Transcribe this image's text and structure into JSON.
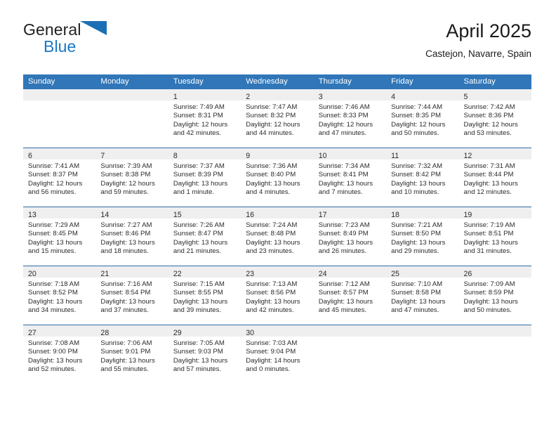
{
  "brand": {
    "name_top": "General",
    "name_bottom": "Blue",
    "triangle_icon": "triangle-icon",
    "color_dark": "#221f1f",
    "color_blue": "#1878c8"
  },
  "header": {
    "title": "April 2025",
    "subtitle": "Castejon, Navarre, Spain"
  },
  "theme": {
    "header_row_bg": "#3076b8",
    "row_divider": "#2e6da4",
    "daynum_band_bg": "#efefef",
    "text": "#2b2b2b"
  },
  "calendar": {
    "weekday_headers": [
      "Sunday",
      "Monday",
      "Tuesday",
      "Wednesday",
      "Thursday",
      "Friday",
      "Saturday"
    ],
    "weeks": [
      [
        {
          "day": "",
          "empty": true,
          "sunrise": "",
          "sunset": "",
          "daylight_1": "",
          "daylight_2": ""
        },
        {
          "day": "",
          "empty": true,
          "sunrise": "",
          "sunset": "",
          "daylight_1": "",
          "daylight_2": ""
        },
        {
          "day": "1",
          "empty": false,
          "sunrise": "Sunrise: 7:49 AM",
          "sunset": "Sunset: 8:31 PM",
          "daylight_1": "Daylight: 12 hours",
          "daylight_2": "and 42 minutes."
        },
        {
          "day": "2",
          "empty": false,
          "sunrise": "Sunrise: 7:47 AM",
          "sunset": "Sunset: 8:32 PM",
          "daylight_1": "Daylight: 12 hours",
          "daylight_2": "and 44 minutes."
        },
        {
          "day": "3",
          "empty": false,
          "sunrise": "Sunrise: 7:46 AM",
          "sunset": "Sunset: 8:33 PM",
          "daylight_1": "Daylight: 12 hours",
          "daylight_2": "and 47 minutes."
        },
        {
          "day": "4",
          "empty": false,
          "sunrise": "Sunrise: 7:44 AM",
          "sunset": "Sunset: 8:35 PM",
          "daylight_1": "Daylight: 12 hours",
          "daylight_2": "and 50 minutes."
        },
        {
          "day": "5",
          "empty": false,
          "sunrise": "Sunrise: 7:42 AM",
          "sunset": "Sunset: 8:36 PM",
          "daylight_1": "Daylight: 12 hours",
          "daylight_2": "and 53 minutes."
        }
      ],
      [
        {
          "day": "6",
          "empty": false,
          "sunrise": "Sunrise: 7:41 AM",
          "sunset": "Sunset: 8:37 PM",
          "daylight_1": "Daylight: 12 hours",
          "daylight_2": "and 56 minutes."
        },
        {
          "day": "7",
          "empty": false,
          "sunrise": "Sunrise: 7:39 AM",
          "sunset": "Sunset: 8:38 PM",
          "daylight_1": "Daylight: 12 hours",
          "daylight_2": "and 59 minutes."
        },
        {
          "day": "8",
          "empty": false,
          "sunrise": "Sunrise: 7:37 AM",
          "sunset": "Sunset: 8:39 PM",
          "daylight_1": "Daylight: 13 hours",
          "daylight_2": "and 1 minute."
        },
        {
          "day": "9",
          "empty": false,
          "sunrise": "Sunrise: 7:36 AM",
          "sunset": "Sunset: 8:40 PM",
          "daylight_1": "Daylight: 13 hours",
          "daylight_2": "and 4 minutes."
        },
        {
          "day": "10",
          "empty": false,
          "sunrise": "Sunrise: 7:34 AM",
          "sunset": "Sunset: 8:41 PM",
          "daylight_1": "Daylight: 13 hours",
          "daylight_2": "and 7 minutes."
        },
        {
          "day": "11",
          "empty": false,
          "sunrise": "Sunrise: 7:32 AM",
          "sunset": "Sunset: 8:42 PM",
          "daylight_1": "Daylight: 13 hours",
          "daylight_2": "and 10 minutes."
        },
        {
          "day": "12",
          "empty": false,
          "sunrise": "Sunrise: 7:31 AM",
          "sunset": "Sunset: 8:44 PM",
          "daylight_1": "Daylight: 13 hours",
          "daylight_2": "and 12 minutes."
        }
      ],
      [
        {
          "day": "13",
          "empty": false,
          "sunrise": "Sunrise: 7:29 AM",
          "sunset": "Sunset: 8:45 PM",
          "daylight_1": "Daylight: 13 hours",
          "daylight_2": "and 15 minutes."
        },
        {
          "day": "14",
          "empty": false,
          "sunrise": "Sunrise: 7:27 AM",
          "sunset": "Sunset: 8:46 PM",
          "daylight_1": "Daylight: 13 hours",
          "daylight_2": "and 18 minutes."
        },
        {
          "day": "15",
          "empty": false,
          "sunrise": "Sunrise: 7:26 AM",
          "sunset": "Sunset: 8:47 PM",
          "daylight_1": "Daylight: 13 hours",
          "daylight_2": "and 21 minutes."
        },
        {
          "day": "16",
          "empty": false,
          "sunrise": "Sunrise: 7:24 AM",
          "sunset": "Sunset: 8:48 PM",
          "daylight_1": "Daylight: 13 hours",
          "daylight_2": "and 23 minutes."
        },
        {
          "day": "17",
          "empty": false,
          "sunrise": "Sunrise: 7:23 AM",
          "sunset": "Sunset: 8:49 PM",
          "daylight_1": "Daylight: 13 hours",
          "daylight_2": "and 26 minutes."
        },
        {
          "day": "18",
          "empty": false,
          "sunrise": "Sunrise: 7:21 AM",
          "sunset": "Sunset: 8:50 PM",
          "daylight_1": "Daylight: 13 hours",
          "daylight_2": "and 29 minutes."
        },
        {
          "day": "19",
          "empty": false,
          "sunrise": "Sunrise: 7:19 AM",
          "sunset": "Sunset: 8:51 PM",
          "daylight_1": "Daylight: 13 hours",
          "daylight_2": "and 31 minutes."
        }
      ],
      [
        {
          "day": "20",
          "empty": false,
          "sunrise": "Sunrise: 7:18 AM",
          "sunset": "Sunset: 8:52 PM",
          "daylight_1": "Daylight: 13 hours",
          "daylight_2": "and 34 minutes."
        },
        {
          "day": "21",
          "empty": false,
          "sunrise": "Sunrise: 7:16 AM",
          "sunset": "Sunset: 8:54 PM",
          "daylight_1": "Daylight: 13 hours",
          "daylight_2": "and 37 minutes."
        },
        {
          "day": "22",
          "empty": false,
          "sunrise": "Sunrise: 7:15 AM",
          "sunset": "Sunset: 8:55 PM",
          "daylight_1": "Daylight: 13 hours",
          "daylight_2": "and 39 minutes."
        },
        {
          "day": "23",
          "empty": false,
          "sunrise": "Sunrise: 7:13 AM",
          "sunset": "Sunset: 8:56 PM",
          "daylight_1": "Daylight: 13 hours",
          "daylight_2": "and 42 minutes."
        },
        {
          "day": "24",
          "empty": false,
          "sunrise": "Sunrise: 7:12 AM",
          "sunset": "Sunset: 8:57 PM",
          "daylight_1": "Daylight: 13 hours",
          "daylight_2": "and 45 minutes."
        },
        {
          "day": "25",
          "empty": false,
          "sunrise": "Sunrise: 7:10 AM",
          "sunset": "Sunset: 8:58 PM",
          "daylight_1": "Daylight: 13 hours",
          "daylight_2": "and 47 minutes."
        },
        {
          "day": "26",
          "empty": false,
          "sunrise": "Sunrise: 7:09 AM",
          "sunset": "Sunset: 8:59 PM",
          "daylight_1": "Daylight: 13 hours",
          "daylight_2": "and 50 minutes."
        }
      ],
      [
        {
          "day": "27",
          "empty": false,
          "sunrise": "Sunrise: 7:08 AM",
          "sunset": "Sunset: 9:00 PM",
          "daylight_1": "Daylight: 13 hours",
          "daylight_2": "and 52 minutes."
        },
        {
          "day": "28",
          "empty": false,
          "sunrise": "Sunrise: 7:06 AM",
          "sunset": "Sunset: 9:01 PM",
          "daylight_1": "Daylight: 13 hours",
          "daylight_2": "and 55 minutes."
        },
        {
          "day": "29",
          "empty": false,
          "sunrise": "Sunrise: 7:05 AM",
          "sunset": "Sunset: 9:03 PM",
          "daylight_1": "Daylight: 13 hours",
          "daylight_2": "and 57 minutes."
        },
        {
          "day": "30",
          "empty": false,
          "sunrise": "Sunrise: 7:03 AM",
          "sunset": "Sunset: 9:04 PM",
          "daylight_1": "Daylight: 14 hours",
          "daylight_2": "and 0 minutes."
        },
        {
          "day": "",
          "empty": true,
          "sunrise": "",
          "sunset": "",
          "daylight_1": "",
          "daylight_2": ""
        },
        {
          "day": "",
          "empty": true,
          "sunrise": "",
          "sunset": "",
          "daylight_1": "",
          "daylight_2": ""
        },
        {
          "day": "",
          "empty": true,
          "sunrise": "",
          "sunset": "",
          "daylight_1": "",
          "daylight_2": ""
        }
      ]
    ]
  }
}
